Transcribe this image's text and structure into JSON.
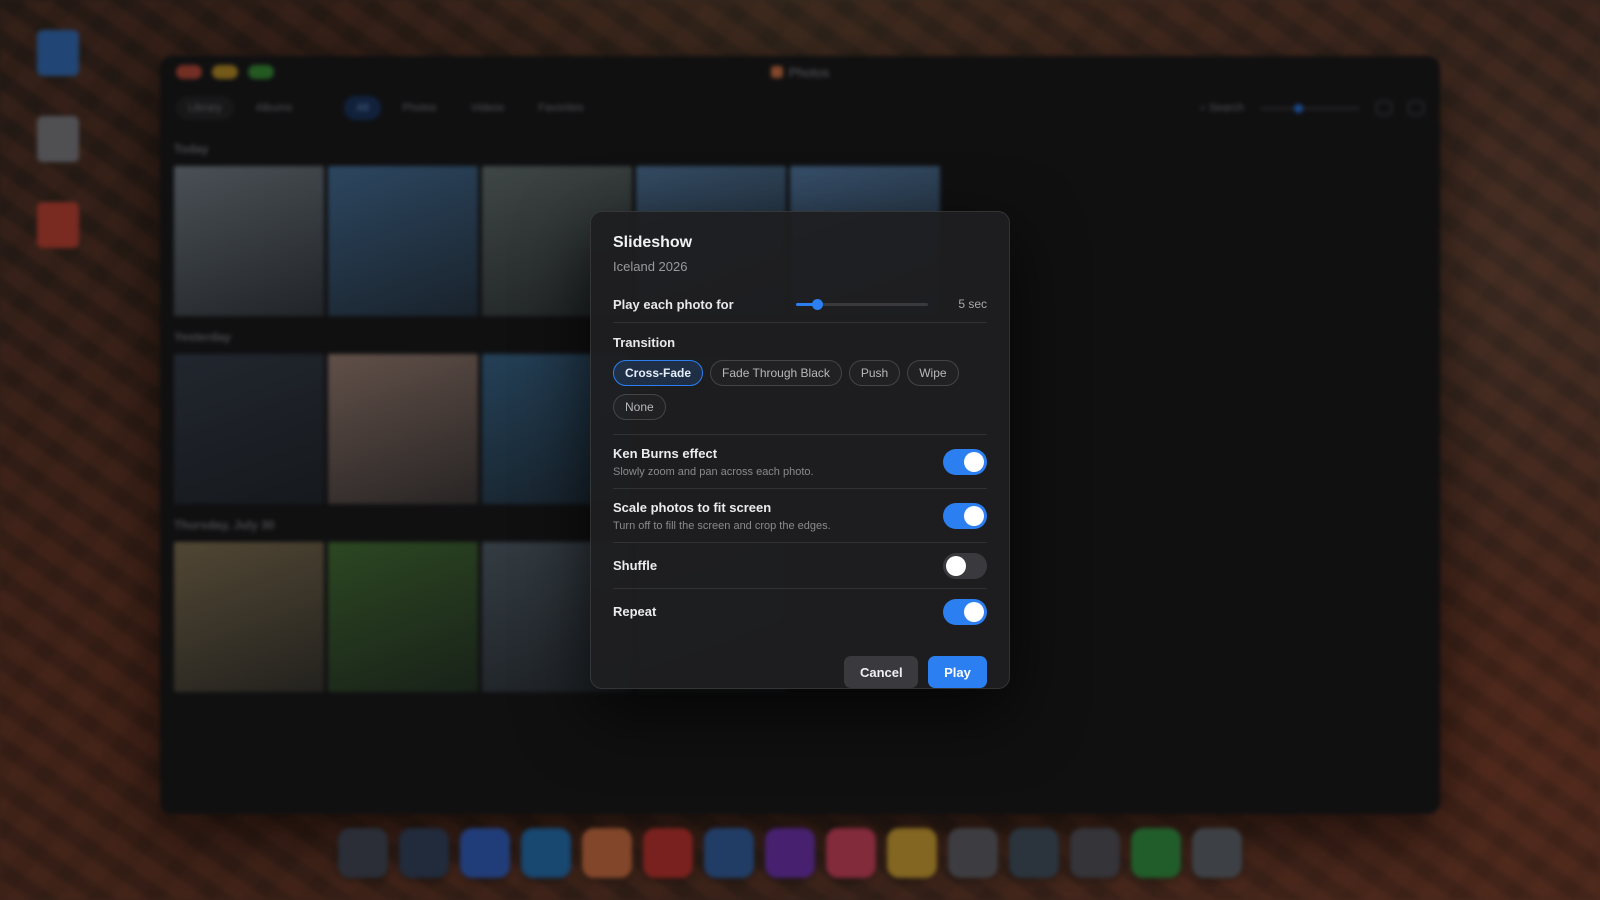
{
  "desktop": {
    "icons": [
      {
        "label": "",
        "color": "#3a78c8"
      },
      {
        "label": "",
        "color": "#8a8a90"
      },
      {
        "label": "",
        "color": "#d04a3a"
      }
    ]
  },
  "window": {
    "title": "Photos",
    "toolbar": {
      "tabs": [
        "Library",
        "Albums"
      ],
      "filters": [
        {
          "label": "All",
          "active": true
        },
        {
          "label": "Photos",
          "active": false
        },
        {
          "label": "Videos",
          "active": false
        },
        {
          "label": "Favorites",
          "active": false
        }
      ],
      "search_label": "Search"
    },
    "sections": [
      {
        "title": "Today",
        "thumbs": [
          "#7f8a93",
          "#4d7aa6",
          "#6d7a78",
          "#5a82ab",
          "#5e88b6"
        ]
      },
      {
        "title": "Yesterday",
        "thumbs": [
          "#3a4250",
          "#a88a7e",
          "#3f6f96",
          "#2e3a4a"
        ]
      },
      {
        "title": "Thursday, July 30",
        "thumbs": [
          "#8c7a5a",
          "#4c7a3a",
          "#5a6874",
          "#3c4840"
        ]
      }
    ]
  },
  "dialog": {
    "title": "Slideshow",
    "subtitle": "Iceland 2026",
    "duration": {
      "label": "Play each photo for",
      "value_text": "5 sec",
      "fraction": 0.16
    },
    "transition": {
      "label": "Transition",
      "options": [
        "Cross-Fade",
        "Fade Through Black",
        "Push",
        "Wipe",
        "None"
      ],
      "selected": "Cross-Fade"
    },
    "options": [
      {
        "title": "Ken Burns effect",
        "description": "Slowly zoom and pan across each photo.",
        "on": true
      },
      {
        "title": "Scale photos to fit screen",
        "description": "Turn off to fill the screen and crop the edges.",
        "on": true
      },
      {
        "title": "Shuffle",
        "description": "",
        "on": false
      },
      {
        "title": "Repeat",
        "description": "",
        "on": true
      }
    ],
    "buttons": {
      "cancel": "Cancel",
      "play": "Play"
    }
  },
  "dock": {
    "items": [
      {
        "name": "launchpad",
        "color": "#4a5060"
      },
      {
        "name": "finder-search",
        "color": "#3a4a66"
      },
      {
        "name": "safari",
        "color": "#3a6ad0"
      },
      {
        "name": "mail",
        "color": "#2a7ac0"
      },
      {
        "name": "photos",
        "color": "#e07a4a"
      },
      {
        "name": "pdf",
        "color": "#d03a34"
      },
      {
        "name": "files",
        "color": "#3a6ab0"
      },
      {
        "name": "podcasts",
        "color": "#7a3ac0"
      },
      {
        "name": "music",
        "color": "#e04a66"
      },
      {
        "name": "notes",
        "color": "#e0b03a"
      },
      {
        "name": "trash",
        "color": "#6a6a70"
      },
      {
        "name": "camera",
        "color": "#4a5a6a"
      },
      {
        "name": "settings",
        "color": "#5a5a62"
      },
      {
        "name": "messages",
        "color": "#3aa04a"
      },
      {
        "name": "bin",
        "color": "#6a7078"
      }
    ]
  }
}
